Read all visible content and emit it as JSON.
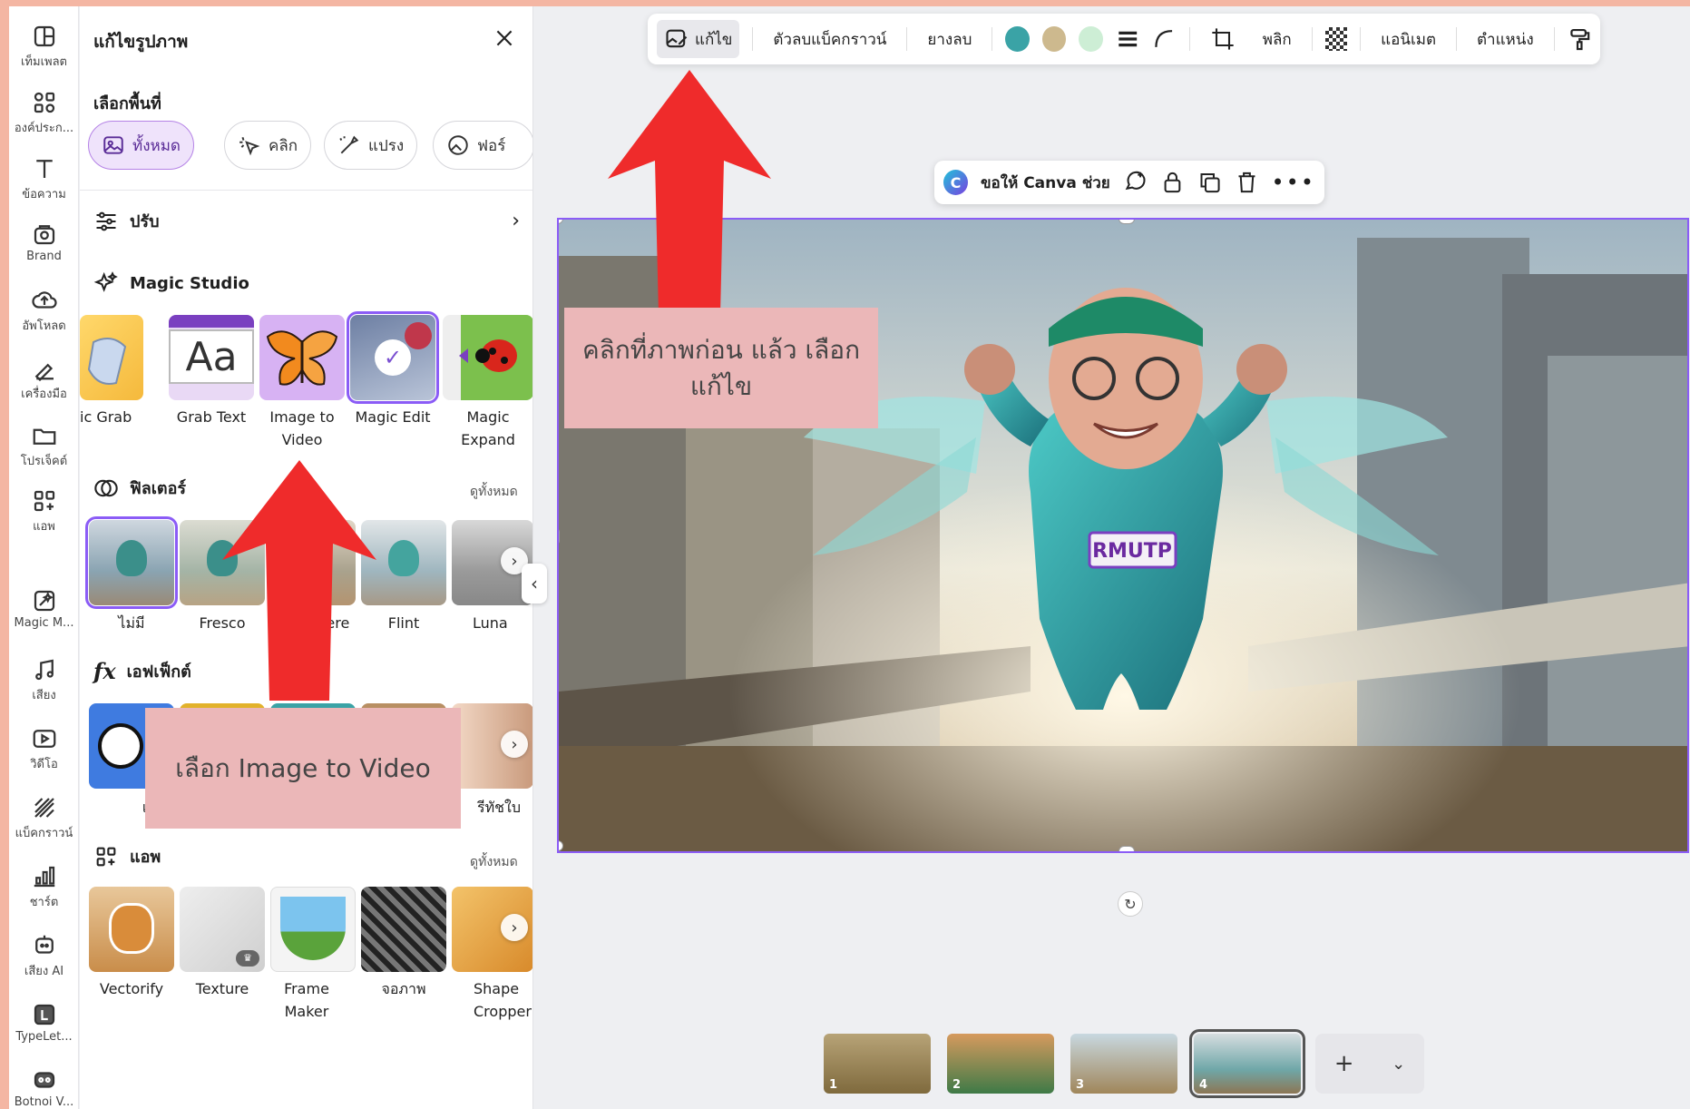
{
  "rail": [
    {
      "icon": "template-icon",
      "label": "เท็มเพลต"
    },
    {
      "icon": "elements-icon",
      "label": "องค์ประก..."
    },
    {
      "icon": "text-icon",
      "label": "ข้อความ"
    },
    {
      "icon": "brand-icon",
      "label": "Brand"
    },
    {
      "icon": "upload-icon",
      "label": "อัพโหลด"
    },
    {
      "icon": "tools-icon",
      "label": "เครื่องมือ"
    },
    {
      "icon": "projects-icon",
      "label": "โปรเจ็คต์"
    },
    {
      "icon": "apps-icon",
      "label": "แอพ"
    },
    {
      "icon": "magic-icon",
      "label": "Magic M..."
    },
    {
      "icon": "audio-icon",
      "label": "เสียง"
    },
    {
      "icon": "video-icon",
      "label": "วิดีโอ"
    },
    {
      "icon": "background-icon",
      "label": "แบ็คกราวน์"
    },
    {
      "icon": "chart-icon",
      "label": "ชาร์ต"
    },
    {
      "icon": "ai-voice-icon",
      "label": "เสียง AI"
    },
    {
      "icon": "typelet-icon",
      "label": "TypeLet..."
    },
    {
      "icon": "bot-icon",
      "label": "Botnoi V..."
    }
  ],
  "panel": {
    "title": "แก้ไขรูปภาพ",
    "select_area_title": "เลือกพื้นที่",
    "chips": [
      "ทั้งหมด",
      "คลิก",
      "แปรง",
      "ฟอร์"
    ],
    "adjust_label": "ปรับ",
    "magic_studio_title": "Magic Studio",
    "magic_tools": [
      "ic Grab",
      "Grab Text",
      "Image to Video",
      "Magic Edit",
      "Magic Expand"
    ],
    "filters_title": "ฟิลเตอร์",
    "filters_see_all": "ดูทั้งหมด",
    "filters": [
      "ไม่มี",
      "Fresco",
      "Belvedere",
      "Flint",
      "Luna"
    ],
    "effects_title": "เอฟเฟ็กต์",
    "effects": [
      "เงา",
      "",
      "",
      "",
      "รีทัชใบ"
    ],
    "apps_title": "แอพ",
    "apps_see_all": "ดูทั้งหมด",
    "apps": [
      "Vectorify",
      "Texture",
      "Frame Maker",
      "จอภาพ",
      "Shape Cropper"
    ]
  },
  "toolbar": {
    "edit": "แก้ไข",
    "bg_remover": "ตัวลบแบ็คกราวน์",
    "eraser": "ยางลบ",
    "colors": [
      "#3aa3a6",
      "#cdb98e",
      "#cdeed5"
    ],
    "flip": "พลิก",
    "animate": "แอนิเมต",
    "position": "ตำแหน่ง"
  },
  "float_menu": {
    "ask_canva": "ขอให้ Canva ช่วย"
  },
  "canvas": {
    "chest_text": "RMUTP"
  },
  "pages": [
    "1",
    "2",
    "3",
    "4"
  ],
  "notes": {
    "top": "คลิกที่ภาพก่อน แล้ว เลือกแก้ไข",
    "left": "เลือก Image to Video"
  },
  "accent": "#8b5cf6"
}
